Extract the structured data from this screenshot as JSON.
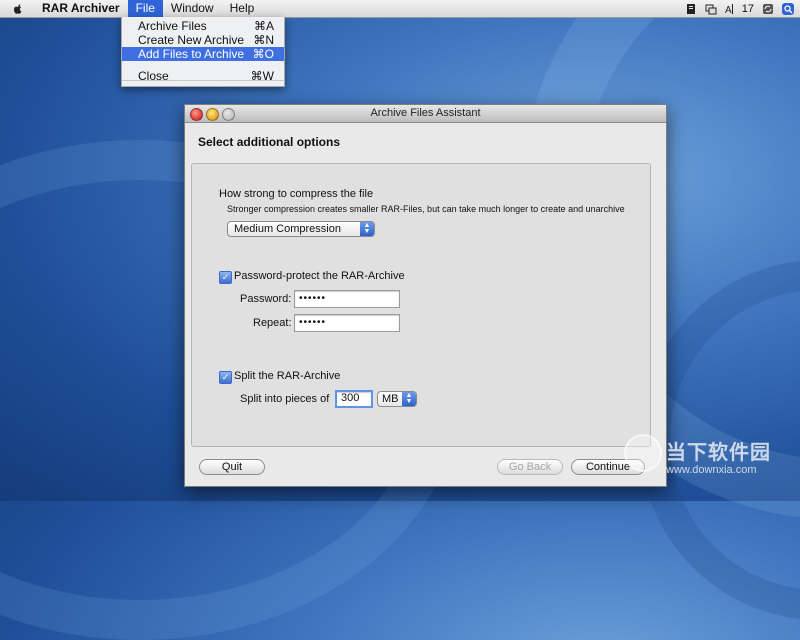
{
  "menubar": {
    "app_name": "RAR Archiver",
    "menus": [
      "File",
      "Window",
      "Help"
    ],
    "status": {
      "clock": "17"
    }
  },
  "file_menu": {
    "items": [
      {
        "label": "Archive Files",
        "shortcut": "⌘A"
      },
      {
        "label": "Create New Archive",
        "shortcut": "⌘N"
      },
      {
        "label": "Add Files to Archive",
        "shortcut": "⌘O"
      },
      {
        "label": "Close",
        "shortcut": "⌘W"
      }
    ],
    "highlighted_index": 2
  },
  "window": {
    "title": "Archive Files Assistant",
    "heading": "Select additional options",
    "compression": {
      "label": "How strong to compress the file",
      "hint": "Stronger compression creates smaller RAR-Files, but can take much longer to create and unarchive",
      "selected": "Medium Compression"
    },
    "password": {
      "checkbox_label": "Password-protect the RAR-Archive",
      "checked": true,
      "password_label": "Password:",
      "password_value": "••••••",
      "repeat_label": "Repeat:",
      "repeat_value": "••••••"
    },
    "split": {
      "checkbox_label": "Split the RAR-Archive",
      "checked": true,
      "pieces_label": "Split into pieces of",
      "size_value": "300",
      "unit": "MB"
    },
    "buttons": {
      "quit": "Quit",
      "go_back": "Go Back",
      "continue": "Continue"
    }
  },
  "watermark": {
    "line1": "当下软件园",
    "line2": "www.downxia.com"
  },
  "colors": {
    "menu_highlight": "#3f6fe0",
    "desktop": "#2f63b0"
  }
}
